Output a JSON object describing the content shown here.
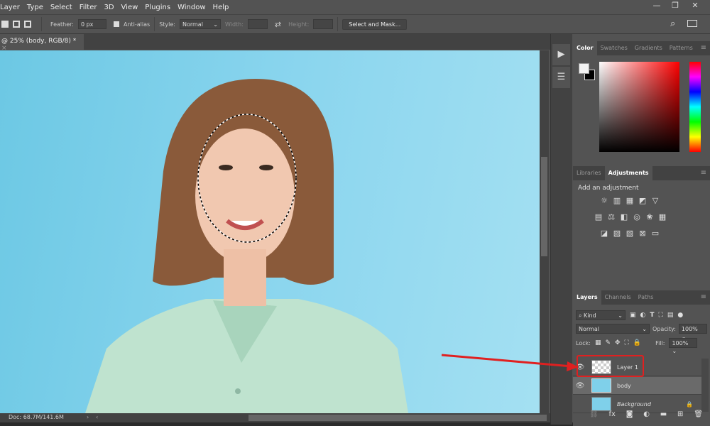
{
  "menu": [
    "Layer",
    "Type",
    "Select",
    "Filter",
    "3D",
    "View",
    "Plugins",
    "Window",
    "Help"
  ],
  "window_controls": {
    "minimize": "—",
    "restore": "❐",
    "close": "✕"
  },
  "options": {
    "feather_label": "Feather:",
    "feather_value": "0 px",
    "antialias_label": "Anti-alias",
    "antialias_checked": true,
    "style_label": "Style:",
    "style_value": "Normal",
    "width_label": "Width:",
    "height_label": "Height:",
    "select_mask": "Select and Mask..."
  },
  "doc_tab": {
    "title": "@ 25% (body, RGB/8) *",
    "close": "×"
  },
  "status": {
    "doc": "Doc: 68.7M/141.6M"
  },
  "color_panel": {
    "tabs": [
      "Color",
      "Swatches",
      "Gradients",
      "Patterns"
    ],
    "active": "Color",
    "foreground": "#f2f2f2",
    "background": "#000000",
    "hue": "#ff0000"
  },
  "adjustments_panel": {
    "tabs": [
      "Libraries",
      "Adjustments"
    ],
    "active": "Adjustments",
    "heading": "Add an adjustment",
    "rows": [
      [
        "☼",
        "▥",
        "▦",
        "◩",
        "▽"
      ],
      [
        "▤",
        "⚖",
        "◧",
        "◎",
        "❀",
        "▦"
      ],
      [
        "◪",
        "▨",
        "▧",
        "⊠",
        "▭"
      ]
    ]
  },
  "layers_panel": {
    "tabs": [
      "Layers",
      "Channels",
      "Paths"
    ],
    "active": "Layers",
    "filter": "Kind",
    "blend_mode": "Normal",
    "opacity_label": "Opacity:",
    "opacity": "100%",
    "lock_label": "Lock:",
    "fill_label": "Fill:",
    "fill": "100%",
    "layers": [
      {
        "name": "Layer 1",
        "visible": true,
        "highlighted": true
      },
      {
        "name": "body",
        "visible": true,
        "selected": true
      },
      {
        "name": "Background",
        "visible": false,
        "locked": true
      }
    ],
    "footer_icons": [
      "link",
      "fx",
      "mask",
      "adjustment",
      "group",
      "new-layer",
      "trash"
    ]
  },
  "annotation": {
    "color": "#e02020"
  }
}
